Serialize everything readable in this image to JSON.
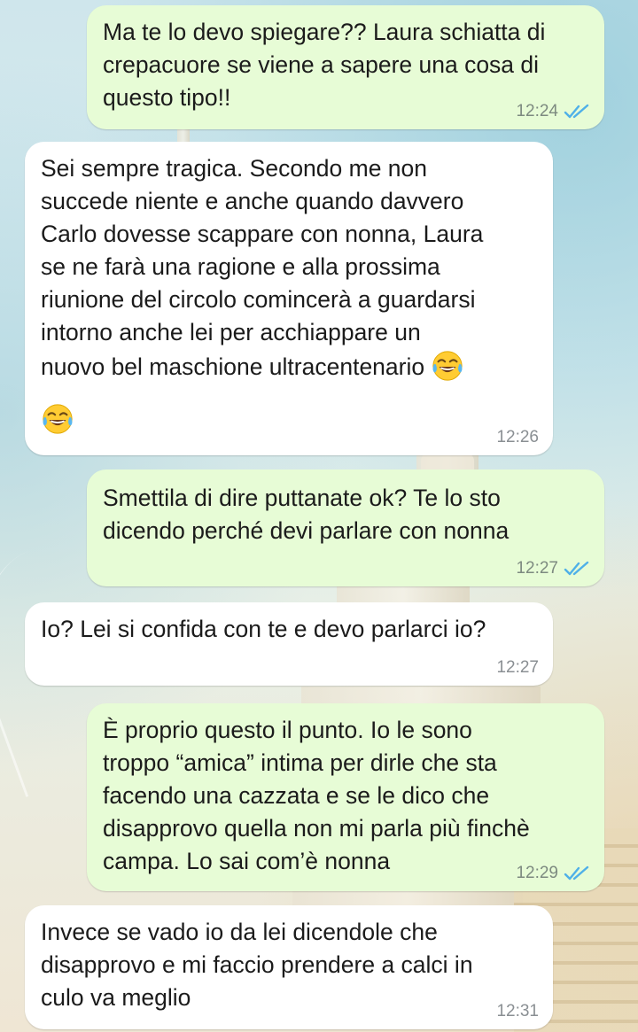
{
  "messages": [
    {
      "direction": "out",
      "text": "Ma te lo devo spiegare?? Laura schiatta di\ncrepacuore se viene a sapere una cosa di\nquesto tipo!!",
      "time": "12:24",
      "status_icon": "double-check-read-icon"
    },
    {
      "direction": "in",
      "text": "Sei sempre tragica. Secondo me non\nsuccede niente e anche quando davvero\nCarlo dovesse scappare con nonna, Laura\nse ne farà una ragione e alla prossima\nriunione del circolo comincerà a guardarsi\nintorno anche lei per acchiappare un\nnuovo bel maschione ultracentenario",
      "emojis": [
        "face-with-tears-of-joy",
        "face-with-tears-of-joy"
      ],
      "time": "12:26"
    },
    {
      "direction": "out",
      "text": "Smettila di dire puttanate ok? Te lo sto\ndicendo perché devi parlare con nonna",
      "time": "12:27",
      "status_icon": "double-check-read-icon"
    },
    {
      "direction": "in",
      "text": "Io? Lei si confida con te e devo parlarci io?",
      "time": "12:27"
    },
    {
      "direction": "out",
      "text": "È proprio questo il punto. Io le sono\ntroppo “amica” intima per dirle che sta\nfacendo una cazzata e se le dico che\ndisapprovo quella non mi parla più finchè\ncampa. Lo sai com’è nonna",
      "time": "12:29",
      "status_icon": "double-check-read-icon"
    },
    {
      "direction": "in",
      "text": "Invece se vado io da lei dicendole che\ndisapprovo e mi faccio prendere a calci in\nculo va meglio",
      "time": "12:31"
    }
  ],
  "colors": {
    "outgoing_bubble": "#e7fcd6",
    "incoming_bubble": "#ffffff",
    "read_ticks": "#4fb0e8",
    "time_text": "#7d8a80"
  }
}
